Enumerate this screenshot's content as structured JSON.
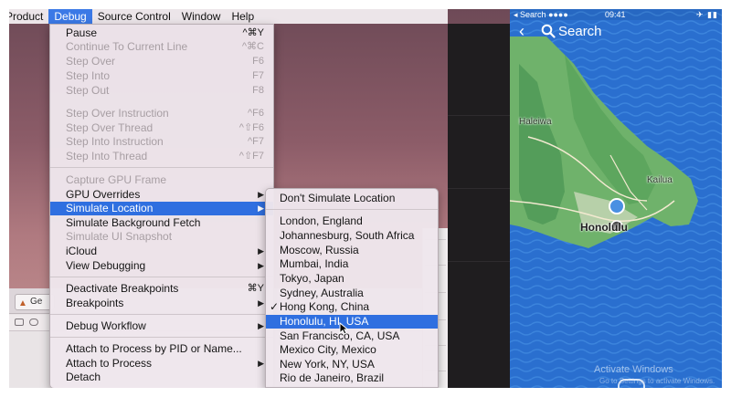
{
  "menubar": {
    "items": [
      {
        "label": "Product"
      },
      {
        "label": "Debug"
      },
      {
        "label": "Source Control"
      },
      {
        "label": "Window"
      },
      {
        "label": "Help"
      }
    ]
  },
  "debug_menu": {
    "items": [
      {
        "label": "Pause",
        "shortcut": "^⌘Y"
      },
      {
        "label": "Continue To Current Line",
        "shortcut": "^⌘C"
      },
      {
        "label": "Step Over",
        "shortcut": "F6"
      },
      {
        "label": "Step Into",
        "shortcut": "F7"
      },
      {
        "label": "Step Out",
        "shortcut": "F8"
      },
      {
        "label": "Step Over Instruction",
        "shortcut": "^F6"
      },
      {
        "label": "Step Over Thread",
        "shortcut": "^⇧F6"
      },
      {
        "label": "Step Into Instruction",
        "shortcut": "^F7"
      },
      {
        "label": "Step Into Thread",
        "shortcut": "^⇧F7"
      },
      {
        "label": "Capture GPU Frame"
      },
      {
        "label": "GPU Overrides"
      },
      {
        "label": "Simulate Location"
      },
      {
        "label": "Simulate Background Fetch"
      },
      {
        "label": "Simulate UI Snapshot"
      },
      {
        "label": "iCloud"
      },
      {
        "label": "View Debugging"
      },
      {
        "label": "Deactivate Breakpoints",
        "shortcut": "⌘Y"
      },
      {
        "label": "Breakpoints"
      },
      {
        "label": "Debug Workflow"
      },
      {
        "label": "Attach to Process by PID or Name..."
      },
      {
        "label": "Attach to Process"
      },
      {
        "label": "Detach"
      }
    ]
  },
  "location_menu": {
    "items": [
      {
        "label": "Don't Simulate Location"
      },
      {
        "label": "London, England"
      },
      {
        "label": "Johannesburg, South Africa"
      },
      {
        "label": "Moscow, Russia"
      },
      {
        "label": "Mumbai, India"
      },
      {
        "label": "Tokyo, Japan"
      },
      {
        "label": "Sydney, Australia"
      },
      {
        "label": "Hong Kong, China",
        "checked": true
      },
      {
        "label": "Honolulu, HI, USA"
      },
      {
        "label": "San Francisco, CA, USA"
      },
      {
        "label": "Mexico City, Mexico"
      },
      {
        "label": "New York, NY, USA"
      },
      {
        "label": "Rio de Janeiro, Brazil"
      }
    ],
    "check_mark": "✓"
  },
  "xcode": {
    "tab_label": "Ge"
  },
  "phone": {
    "status": {
      "left": "Search",
      "time": "09:41"
    },
    "nav": {
      "back_glyph": "‹",
      "search_label": "Search"
    },
    "map_labels": {
      "haleiwa": "Haleiwa",
      "kailua": "Kailua",
      "honolulu": "Honolulu"
    },
    "watermark": {
      "line1": "Activate Windows",
      "line2": "Go to Settings to activate Windows."
    }
  },
  "colors": {
    "menu_highlight": "#2f6fe0",
    "ocean": "#2a6fcf",
    "land_green": "#6fb26b"
  }
}
